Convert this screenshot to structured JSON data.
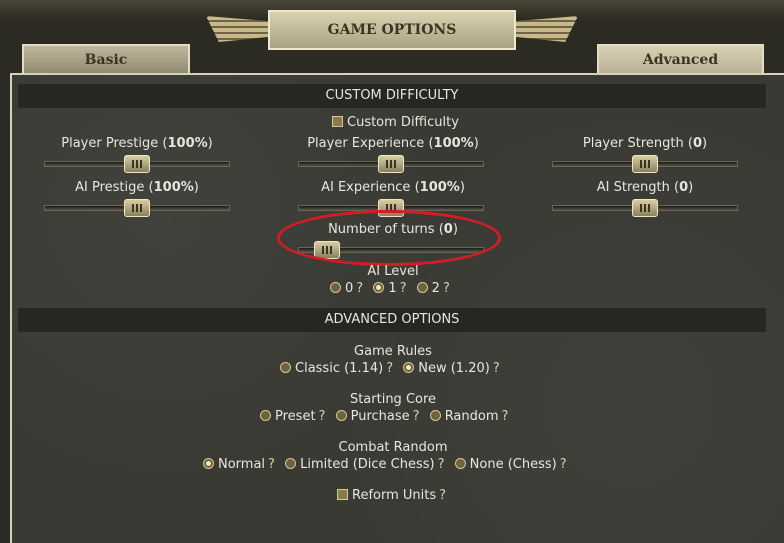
{
  "window": {
    "title": "GAME OPTIONS"
  },
  "tabs": {
    "basic": "Basic",
    "advanced": "Advanced"
  },
  "custom_difficulty": {
    "header": "CUSTOM DIFFICULTY",
    "checkbox_label": "Custom Difficulty",
    "sliders": {
      "player_prestige": {
        "label": "Player Prestige",
        "value": "100%",
        "level": 0.5
      },
      "player_experience": {
        "label": "Player Experience",
        "value": "100%",
        "level": 0.5
      },
      "player_strength": {
        "label": "Player Strength",
        "value": "0",
        "level": 0.5
      },
      "ai_prestige": {
        "label": "AI Prestige",
        "value": "100%",
        "level": 0.5
      },
      "ai_experience": {
        "label": "AI Experience",
        "value": "100%",
        "level": 0.5
      },
      "ai_strength": {
        "label": "AI Strength",
        "value": "0",
        "level": 0.5
      },
      "number_of_turns": {
        "label": "Number of turns",
        "value": "0",
        "level": 0.1
      }
    },
    "ai_level": {
      "label": "AI Level",
      "options": [
        "0",
        "1",
        "2"
      ],
      "selected": "1"
    }
  },
  "advanced_options": {
    "header": "ADVANCED OPTIONS",
    "game_rules": {
      "label": "Game Rules",
      "options": [
        "Classic (1.14)",
        "New (1.20)"
      ],
      "selected": "New (1.20)"
    },
    "starting_core": {
      "label": "Starting Core",
      "options": [
        "Preset",
        "Purchase",
        "Random"
      ],
      "selected": ""
    },
    "combat_random": {
      "label": "Combat Random",
      "options": [
        "Normal",
        "Limited (Dice Chess)",
        "None (Chess)"
      ],
      "selected": "Normal"
    },
    "reform_units": {
      "label": "Reform Units"
    }
  },
  "help_glyph": "?",
  "annotation": {
    "color": "#d41c24"
  }
}
